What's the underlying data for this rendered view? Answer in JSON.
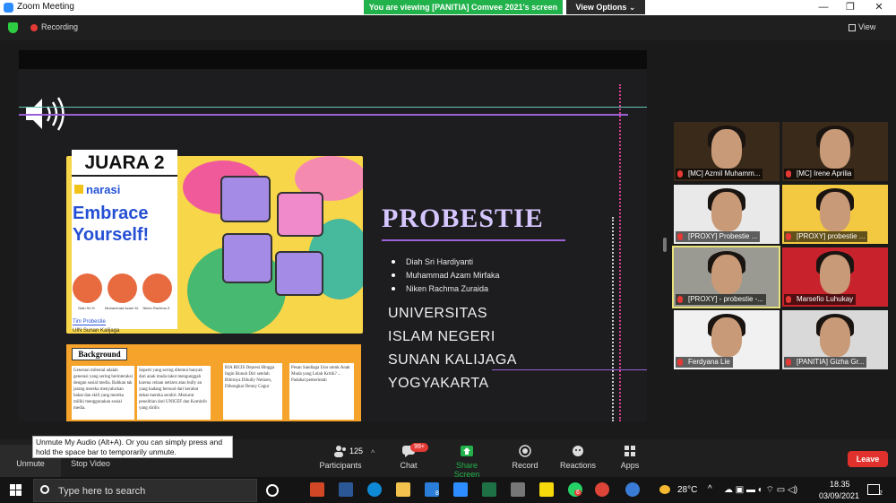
{
  "window": {
    "title": "Zoom Meeting",
    "viewing_banner": "You are viewing [PANITIA] Comvee 2021's screen",
    "view_options": "View Options",
    "minimize": "—",
    "maximize": "❐",
    "close": "✕"
  },
  "infobar": {
    "recording": "Recording",
    "view": "View"
  },
  "slide": {
    "juara": "JUARA 2",
    "narasi": "narasi",
    "embrace_1": "Embrace",
    "embrace_2": "Yourself!",
    "avatars": [
      "Diah Sri H.",
      "Muhammad Azam M.",
      "Niken Rachma Z."
    ],
    "tim": "Tim Probestie",
    "uin": "UIN Sunan Kalijaga",
    "background_title": "Background",
    "news_col1": "Generasi milenial adalah generasi yang sering berinteraksi dengan sosial media. Bahkan tak jarang mereka menyalurkan bakat dan skill yang mereka miliki menggunakan sosial media.",
    "news_col2": "Seperti yang sering ditemui banyak dari anak muda takut mengunggah karena celaan netizen atau bully an yang kadang bersoal dari kerabat dekat mereka sendiri. Menurut penelitian dari UNICEF dan Kominfo yang dirilis",
    "news_col3": "RIA RICIS Depresi Hingga Ingin Bunuh Diri setelah Bibirnya Dibully Netizen, Dibongkar Denny Cagur",
    "news_col4": "Pesan Sandiaga Uno untuk Anak Muda yang Lelah Kritik? ... Padahal pemerintah",
    "probestie": "PROBESTIE",
    "members": [
      "Diah Sri Hardiyanti",
      "Muhammad Azam Mirfaka",
      "Niken Rachma Zuraida"
    ],
    "university": [
      "UNIVERSITAS",
      "ISLAM NEGERI",
      "SUNAN KALIJAGA",
      "YOGYAKARTA"
    ]
  },
  "gallery": [
    {
      "name": "[MC] Azmil Muhamm...",
      "bg": "#3a2a1a"
    },
    {
      "name": "[MC] Irene Aprilia",
      "bg": "#3a2a1a"
    },
    {
      "name": "[PROXY] Probestie ...",
      "bg": "#e9e9e9"
    },
    {
      "name": "[PROXY] probestie ...",
      "bg": "#f3c941"
    },
    {
      "name": "[PROXY] - probestie -...",
      "bg": "#9a9a92"
    },
    {
      "name": "Marsefio Luhukay",
      "bg": "#c8232c"
    },
    {
      "name": "Ferdyana Lie",
      "bg": "#f1f1f1"
    },
    {
      "name": "[PANITIA] Gizha Gr...",
      "bg": "#d9d9d9"
    }
  ],
  "controls": {
    "unmute": "Unmute",
    "stop_video": "Stop Video",
    "participants_count": "125",
    "participants": "Participants",
    "chat": "Chat",
    "chat_badge": "99+",
    "share_screen": "Share Screen",
    "record": "Record",
    "reactions": "Reactions",
    "apps": "Apps",
    "leave": "Leave",
    "tooltip": "Unmute My Audio (Alt+A). Or you can simply press and hold the space bar to temporarily unmute."
  },
  "taskbar": {
    "search_placeholder": "Type here to search",
    "temperature": "28°C",
    "time": "18.35",
    "date": "03/09/2021",
    "mail_badge": "8",
    "whatsapp_badge": "6",
    "notif_count": "2"
  },
  "colors": {
    "zoom_blue": "#2d8cff",
    "banner_green": "#21b24b",
    "leave_red": "#e0312d",
    "slide_purple": "#9b62d8",
    "share_green": "#21b24b"
  }
}
